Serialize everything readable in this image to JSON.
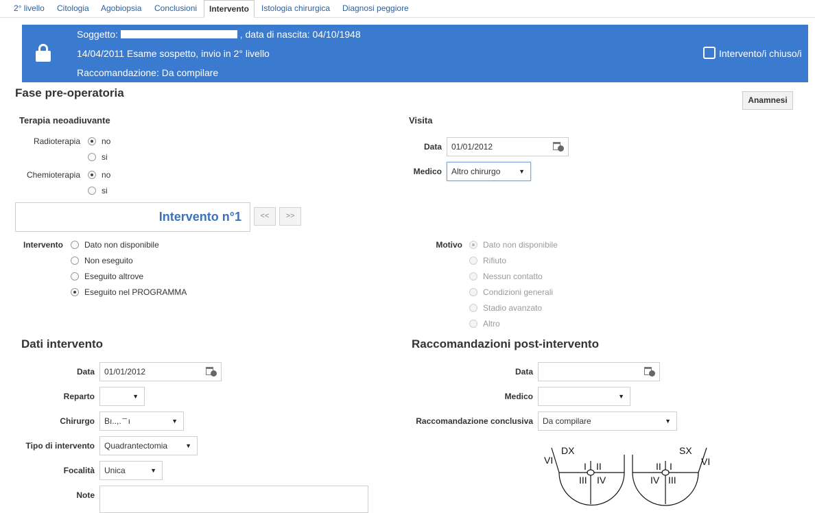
{
  "tabs": [
    {
      "label": "2° livello"
    },
    {
      "label": "Citologia"
    },
    {
      "label": "Agobiopsia"
    },
    {
      "label": "Conclusioni"
    },
    {
      "label": "Intervento"
    },
    {
      "label": "Istologia chirurgica"
    },
    {
      "label": "Diagnosi peggiore"
    }
  ],
  "banner": {
    "subject_prefix": "Soggetto:",
    "birth_text": ", data di nascita: 04/10/1948",
    "exam_line": "14/04/2011 Esame sospetto, invio in 2° livello",
    "recommendation_line": "Raccomandazione: Da compilare",
    "closed_label": "Intervento/i chiuso/i",
    "closed_checked": false,
    "icon": "lock-icon"
  },
  "pre_op": {
    "title": "Fase pre-operatoria",
    "anamnesi_button": "Anamnesi",
    "neoadjuvant": {
      "title": "Terapia neoadiuvante",
      "radioterapia_label": "Radioterapia",
      "chemioterapia_label": "Chemioterapia",
      "no": "no",
      "si": "si",
      "radioterapia_value": "no",
      "chemioterapia_value": "no"
    },
    "visit": {
      "title": "Visita",
      "date_label": "Data",
      "date_value": "01/01/2012",
      "doctor_label": "Medico",
      "doctor_value": "Altro chirurgo"
    }
  },
  "intervention_nav": {
    "title": "Intervento n°1",
    "prev": "<<",
    "next": ">>"
  },
  "intervention": {
    "label": "Intervento",
    "options": [
      "Dato non disponibile",
      "Non eseguito",
      "Eseguito altrove",
      "Eseguito nel PROGRAMMA"
    ],
    "selected": "Eseguito nel PROGRAMMA"
  },
  "reason": {
    "label": "Motivo",
    "options": [
      "Dato non disponibile",
      "Rifiuto",
      "Nessun contatto",
      "Condizioni generali",
      "Stadio avanzato",
      "Altro"
    ],
    "selected": "Dato non disponibile",
    "disabled": true
  },
  "intervention_data": {
    "title": "Dati intervento",
    "date_label": "Data",
    "date_value": "01/01/2012",
    "ward_label": "Reparto",
    "ward_value": "",
    "surgeon_label": "Chirurgo",
    "surgeon_value": "Bı..,. ̄ ̄ ı",
    "type_label": "Tipo di intervento",
    "type_value": "Quadrantectomia",
    "focality_label": "Focalità",
    "focality_value": "Unica",
    "notes_label": "Note"
  },
  "post_op": {
    "title": "Raccomandazioni post-intervento",
    "date_label": "Data",
    "date_value": "",
    "doctor_label": "Medico",
    "doctor_value": "",
    "conclusive_label": "Raccomandazione conclusiva",
    "conclusive_value": "Da compilare"
  },
  "breast_diagram": {
    "dx": "DX",
    "sx": "SX",
    "q1": "I",
    "q2": "II",
    "q3": "III",
    "q4": "IV",
    "q6": "VI"
  }
}
